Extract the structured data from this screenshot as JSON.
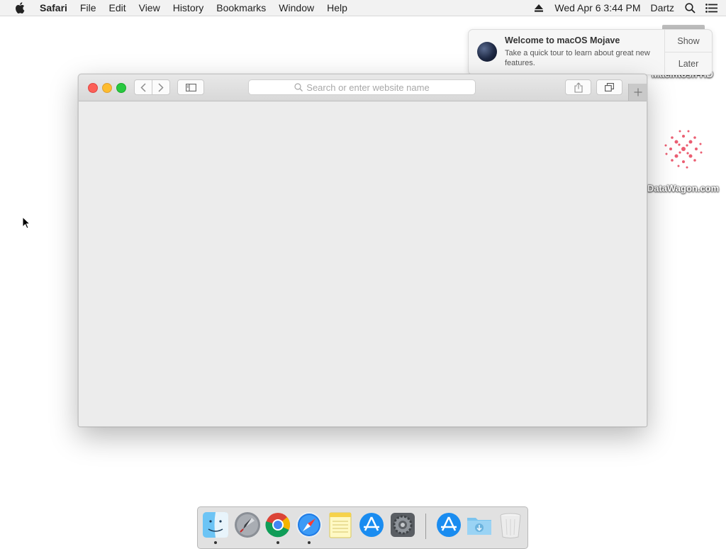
{
  "menubar": {
    "app_name": "Safari",
    "items": [
      "File",
      "Edit",
      "View",
      "History",
      "Bookmarks",
      "Window",
      "Help"
    ],
    "datetime": "Wed Apr 6  3:44 PM",
    "user": "Dartz",
    "icons": [
      "apple-icon",
      "eject-icon",
      "spotlight-icon",
      "notification-center-icon"
    ]
  },
  "desktop": {
    "icons": [
      {
        "label": "Macintosh HD",
        "icon": "hard-drive-icon"
      },
      {
        "label": "DataWagon.com",
        "icon": "image-file-icon"
      }
    ]
  },
  "notification": {
    "title": "Welcome to macOS Mojave",
    "body": "Take a quick tour to learn about great new features.",
    "show_label": "Show",
    "later_label": "Later"
  },
  "safari": {
    "search_placeholder": "Search or enter website name",
    "toolbar_icons": [
      "back-icon",
      "forward-icon",
      "sidebar-icon",
      "share-icon",
      "tabs-overview-icon",
      "new-tab-icon"
    ]
  },
  "dock": {
    "apps": [
      {
        "name": "Finder",
        "icon": "finder-icon",
        "running": true
      },
      {
        "name": "Launchpad",
        "icon": "launchpad-icon",
        "running": false
      },
      {
        "name": "Google Chrome",
        "icon": "chrome-icon",
        "running": true
      },
      {
        "name": "Safari",
        "icon": "safari-icon",
        "running": true
      },
      {
        "name": "Notes",
        "icon": "notes-icon",
        "running": false
      },
      {
        "name": "App Store",
        "icon": "app-store-icon",
        "running": false
      },
      {
        "name": "System Preferences",
        "icon": "system-preferences-icon",
        "running": false
      }
    ],
    "stacks": [
      {
        "name": "Applications",
        "icon": "applications-folder-icon"
      },
      {
        "name": "Downloads",
        "icon": "downloads-folder-icon"
      },
      {
        "name": "Trash",
        "icon": "trash-icon"
      }
    ]
  }
}
